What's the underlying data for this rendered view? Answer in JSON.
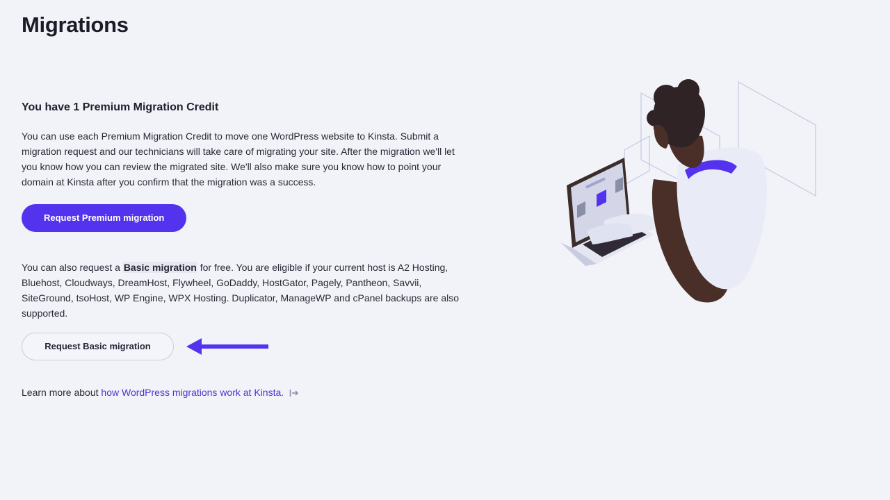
{
  "page": {
    "title": "Migrations"
  },
  "premium": {
    "heading": "You have 1 Premium Migration Credit",
    "description": "You can use each Premium Migration Credit to move one WordPress website to Kinsta. Submit a migration request and our technicians will take care of migrating your site. After the migration we'll let you know how you can review the migrated site. We'll also make sure you know how to point your domain at Kinsta after you confirm that the migration was a success.",
    "button_label": "Request Premium migration"
  },
  "basic": {
    "text_before": "You can also request a ",
    "highlight": "Basic migration",
    "text_after": " for free. You are eligible if your current host is A2 Hosting, Bluehost, Cloudways, DreamHost, Flywheel, GoDaddy, HostGator, Pagely, Pantheon, Savvii, SiteGround, tsoHost, WP Engine, WPX Hosting. Duplicator, ManageWP and cPanel backups are also supported.",
    "button_label": "Request Basic migration"
  },
  "learn_more": {
    "prefix": "Learn more about ",
    "link_text": "how WordPress migrations work at Kinsta."
  },
  "icons": {
    "external": "external-link-icon",
    "arrow": "left-arrow-icon"
  },
  "colors": {
    "accent": "#5333ed",
    "background": "#f2f3f8",
    "link": "#4a35d6"
  }
}
